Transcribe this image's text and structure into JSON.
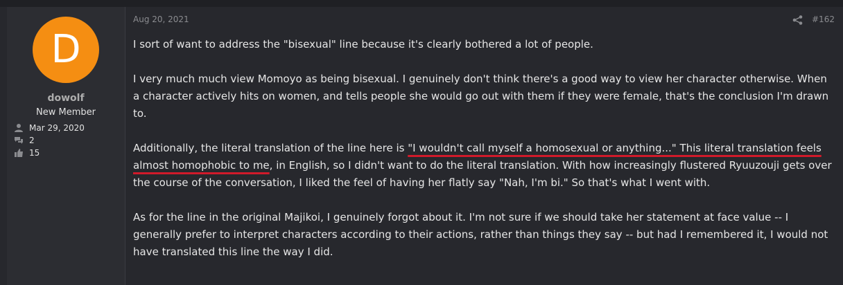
{
  "user": {
    "avatar_letter": "D",
    "avatar_color": "#f58e12",
    "username": "dowolf",
    "title": "New Member",
    "stats": [
      {
        "icon": "user-icon",
        "value": "Mar 29, 2020"
      },
      {
        "icon": "messages-icon",
        "value": "2"
      },
      {
        "icon": "thumbs-up-icon",
        "value": "15"
      }
    ]
  },
  "post": {
    "date": "Aug 20, 2021",
    "share_icon": "share-icon",
    "number": "#162",
    "paragraphs": {
      "p1": "I sort of want to address the \"bisexual\" line because it's clearly bothered a lot of people.",
      "p2": "I very much much view Momoyo as being bisexual. I genuinely don't think there's a good way to view her character otherwise. When a character actively hits on women, and tells people she would go out with them if they were female, that's the conclusion I'm drawn to.",
      "p3_before": "Additionally, the literal translation of the line here is ",
      "p3_highlight": "\"I wouldn't call myself a homosexual or anything...\" This literal translation feels almost homophobic to me",
      "p3_after": ", in English, so I didn't want to do the literal translation. With how increasingly flustered Ryuuzouji gets over the course of the conversation, I liked the feel of having her flatly say \"Nah, I'm bi.\" So that's what I went with.",
      "p4": "As for the line in the original Majikoi, I genuinely forgot about it. I'm not sure if we should take her statement at face value -- I generally prefer to interpret characters according to their actions, rather than things they say -- but had I remembered it, I would not have translated this line the way I did."
    },
    "highlight_color": "#d11a2a"
  }
}
